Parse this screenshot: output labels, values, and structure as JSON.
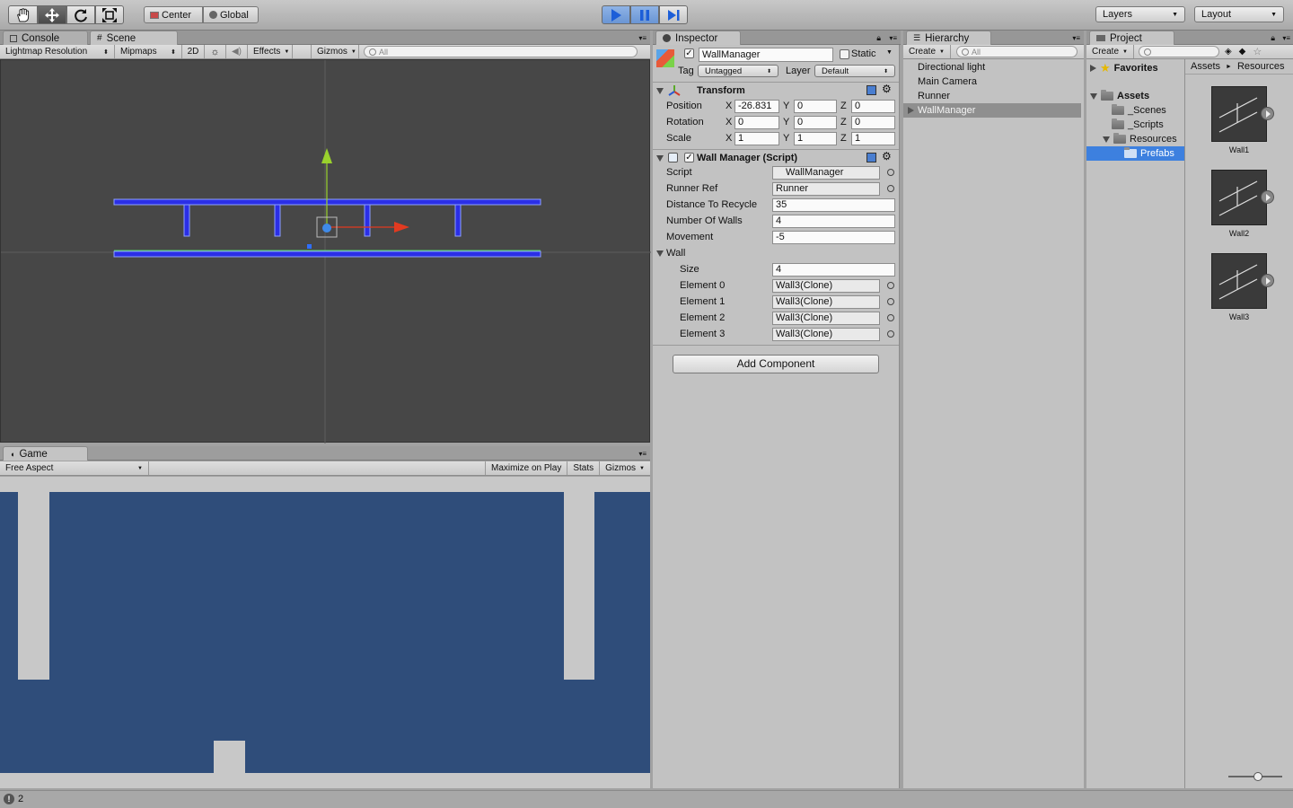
{
  "toolbar": {
    "tools": [
      "hand-icon",
      "move-icon",
      "rotate-icon",
      "scale-icon"
    ],
    "pivot_label": "Center",
    "space_label": "Global",
    "layers_label": "Layers",
    "layout_label": "Layout"
  },
  "scene_panel": {
    "tabs": [
      {
        "label": "Console"
      },
      {
        "label": "Scene"
      }
    ],
    "draw_mode": "Lightmap Resolution",
    "render_mode": "Mipmaps",
    "mode_2d": "2D",
    "effects_label": "Effects",
    "gizmos_label": "Gizmos",
    "search_placeholder": "All"
  },
  "game_panel": {
    "tab_label": "Game",
    "aspect": "Free Aspect",
    "maximize_label": "Maximize on Play",
    "stats_label": "Stats",
    "gizmos_label": "Gizmos"
  },
  "inspector": {
    "tab_label": "Inspector",
    "object_name": "WallManager",
    "static_label": "Static",
    "tag_label": "Tag",
    "tag_value": "Untagged",
    "layer_label": "Layer",
    "layer_value": "Default",
    "transform": {
      "title": "Transform",
      "position_label": "Position",
      "rotation_label": "Rotation",
      "scale_label": "Scale",
      "position": {
        "x": "-26.831",
        "y": "0",
        "z": "0"
      },
      "rotation": {
        "x": "0",
        "y": "0",
        "z": "0"
      },
      "scale": {
        "x": "1",
        "y": "1",
        "z": "1"
      }
    },
    "script_component": {
      "title": "Wall Manager (Script)",
      "script_label": "Script",
      "script_value": "WallManager",
      "runner_ref_label": "Runner Ref",
      "runner_ref_value": "Runner",
      "distance_label": "Distance To Recycle",
      "distance_value": "35",
      "num_walls_label": "Number Of Walls",
      "num_walls_value": "4",
      "movement_label": "Movement",
      "movement_value": "-5",
      "wall_label": "Wall",
      "size_label": "Size",
      "size_value": "4",
      "elements": [
        {
          "label": "Element 0",
          "value": "Wall3(Clone)"
        },
        {
          "label": "Element 1",
          "value": "Wall3(Clone)"
        },
        {
          "label": "Element 2",
          "value": "Wall3(Clone)"
        },
        {
          "label": "Element 3",
          "value": "Wall3(Clone)"
        }
      ]
    },
    "add_component_label": "Add Component"
  },
  "hierarchy": {
    "tab_label": "Hierarchy",
    "create_label": "Create",
    "search_placeholder": "All",
    "items": [
      {
        "label": "Directional light"
      },
      {
        "label": "Main Camera"
      },
      {
        "label": "Runner"
      },
      {
        "label": "WallManager"
      }
    ]
  },
  "project": {
    "tab_label": "Project",
    "create_label": "Create",
    "favorites_label": "Favorites",
    "assets_label": "Assets",
    "folders": [
      {
        "label": "_Scenes"
      },
      {
        "label": "_Scripts"
      },
      {
        "label": "Resources"
      },
      {
        "label": "Prefabs"
      }
    ],
    "breadcrumb": [
      "Assets",
      "Resources"
    ],
    "breadcrumb_sep": "►",
    "assets": [
      {
        "label": "Wall1"
      },
      {
        "label": "Wall2"
      },
      {
        "label": "Wall3"
      }
    ]
  },
  "status": {
    "icon": "info-icon",
    "message": "2"
  },
  "colors": {
    "selection": "#3d80df",
    "game_bg": "#2f4d7a",
    "scene_bg": "#474747",
    "wall_blue": "#2b2fe6"
  }
}
